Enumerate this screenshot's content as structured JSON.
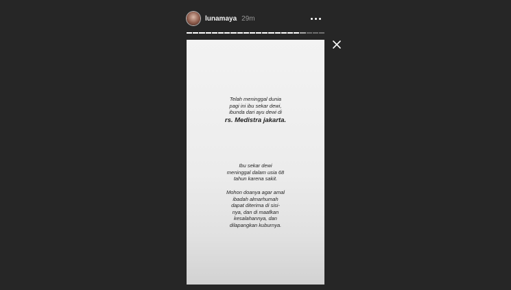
{
  "header": {
    "username": "lunamaya",
    "time": "29m"
  },
  "progress": {
    "segments_total": 22,
    "segments_done": 18,
    "active_index": 18
  },
  "icons": {
    "more": "more-options-icon",
    "close": "close-icon"
  },
  "story": {
    "paragraph1_lines": [
      "Telah meninggal dunia",
      "pagi ini ibu sekar dewi,",
      "ibunda dari ayu dewi di"
    ],
    "paragraph1_big": "rs. Medistra jakarta.",
    "paragraph2_lines": [
      "Ibu sekar dewi",
      "meninggal dalam usia 68",
      "tahun karena sakit."
    ],
    "paragraph3_lines": [
      "Mohon doanya agar amal",
      "ibadah almarhumah",
      "dapat diterima di sisi-",
      "nya, dan di maafkan",
      "kesalahannya, dan",
      "dilapangkan kuburnya."
    ]
  },
  "colors": {
    "background": "#262626",
    "text_light": "#f2f2f2",
    "text_muted": "#9a9a9a",
    "story_text": "#1e1e1e"
  }
}
